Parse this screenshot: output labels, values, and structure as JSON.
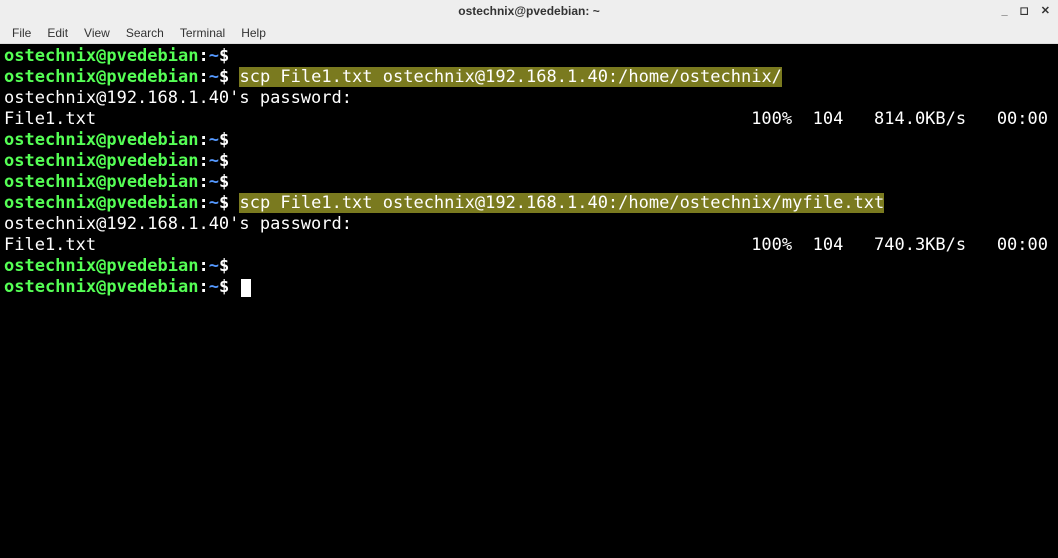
{
  "title": "ostechnix@pvedebian: ~",
  "window_controls": {
    "min": "_",
    "max": "◻",
    "close": "✕"
  },
  "menu": {
    "file": "File",
    "edit": "Edit",
    "view": "View",
    "search": "Search",
    "terminal": "Terminal",
    "help": "Help"
  },
  "prompt": {
    "user_host": "ostechnix@pvedebian",
    "separator": ":",
    "cwd": "~",
    "dollar": "$"
  },
  "lines": [
    {
      "type": "prompt",
      "cmd": ""
    },
    {
      "type": "prompt",
      "cmd": "scp File1.txt ostechnix@192.168.1.40:/home/ostechnix/",
      "highlight": true
    },
    {
      "type": "plain",
      "text": "ostechnix@192.168.1.40's password:"
    },
    {
      "type": "xfer",
      "file": "File1.txt",
      "stats": "100%  104   814.0KB/s   00:00"
    },
    {
      "type": "prompt",
      "cmd": ""
    },
    {
      "type": "prompt",
      "cmd": ""
    },
    {
      "type": "prompt",
      "cmd": ""
    },
    {
      "type": "prompt",
      "cmd": "scp File1.txt ostechnix@192.168.1.40:/home/ostechnix/myfile.txt",
      "highlight": true
    },
    {
      "type": "plain",
      "text": "ostechnix@192.168.1.40's password:"
    },
    {
      "type": "xfer",
      "file": "File1.txt",
      "stats": "100%  104   740.3KB/s   00:00"
    },
    {
      "type": "prompt",
      "cmd": ""
    },
    {
      "type": "prompt",
      "cmd": "",
      "cursor": true
    }
  ]
}
